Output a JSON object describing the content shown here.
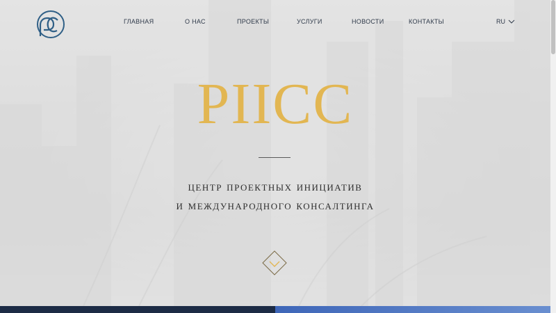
{
  "nav": {
    "items": [
      {
        "label": "ГЛАВНАЯ"
      },
      {
        "label": "О НАС"
      },
      {
        "label": "ПРОЕКТЫ"
      },
      {
        "label": "УСЛУГИ"
      },
      {
        "label": "НОВОСТИ"
      },
      {
        "label": "КОНТАКТЫ"
      }
    ],
    "language": "RU"
  },
  "hero": {
    "title": "PIICC",
    "subtitle_line1": "Центр проектных инициатив",
    "subtitle_line2": "и международного консалтинга"
  },
  "colors": {
    "accent_gold": "#e2b652",
    "logo_blue": "#2f5f86",
    "band_dark": "#1c2b45",
    "band_blue": "#3e66b8"
  },
  "icons": {
    "logo": "piicc-logo-icon",
    "language_chevron": "chevron-down-icon",
    "scroll_down": "diamond-chevron-down-icon"
  }
}
